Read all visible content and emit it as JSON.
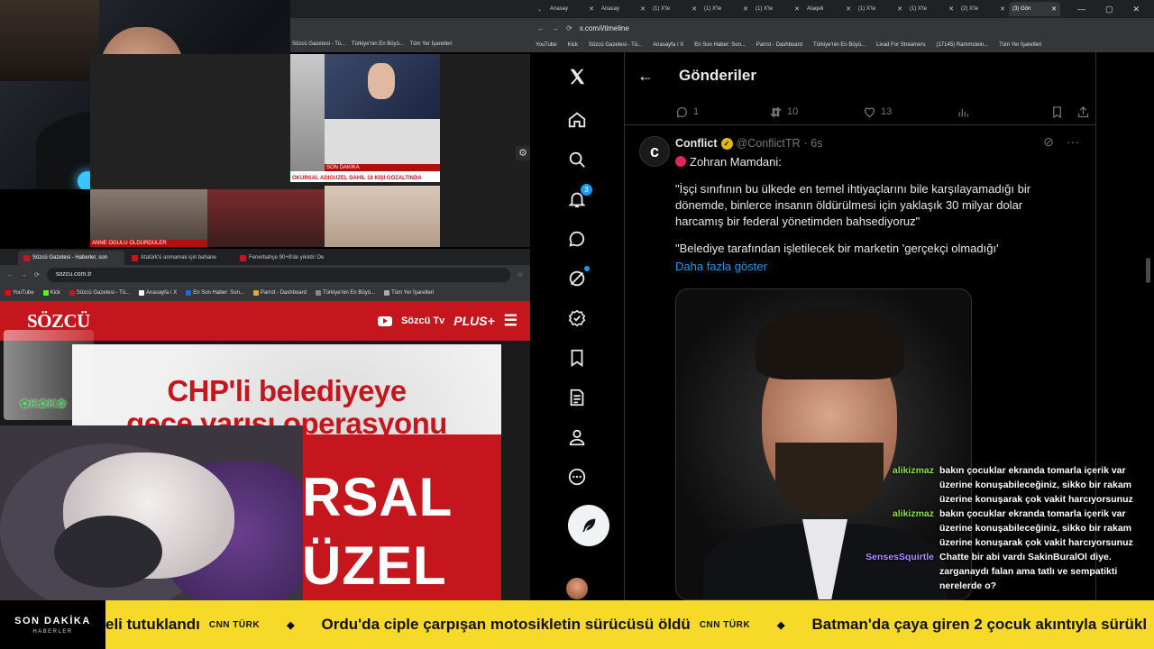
{
  "topLeftWindow": {
    "bookmarks": [
      "Sözcü Gazetesi - Tü...",
      "Türkiye'nin En Büyü...",
      "Tüm Yer İşaretleri"
    ]
  },
  "collage": {
    "captions": [
      "SON DAKİKA",
      "ANNE OĞULU ÖLDÜRDÜLER",
      "OKURSAL ADIGÜZEL DAHİL 18 KİŞİ GÖZALTINDA"
    ]
  },
  "sozcuWindow": {
    "tabs": [
      {
        "label": "Sözcü Gazetesi - Haberler, son"
      },
      {
        "label": "Atatürk'ü anmamak için bahane"
      },
      {
        "label": "Fenerbahçe 90+8'de yıkıldı! De"
      }
    ],
    "url": "sozcu.com.tr",
    "bookmarks": [
      "YouTube",
      "Kick",
      "Sözcü Gazetesi - Tü...",
      "Anasayfa / X",
      "En Son Haber: Son...",
      "Parrot - Dashboard",
      "Türkiye'nin En Büyü...",
      "Tüm Yer İşaretleri"
    ],
    "logo": "SÖZCÜ",
    "tv_label": "Sözcü Tv",
    "plus_label": "PLUS+",
    "hero_title_line1": "CHP'li belediyeye",
    "hero_title_line2": "gece yarısı operasyonu",
    "hero_big_line1": "RSAL",
    "hero_big_line2": "ÜZEL",
    "overlay_text": "✿K✿K✿"
  },
  "xWindow": {
    "tabs": [
      "Anasay",
      "Anasay",
      "(1) X'te",
      "(1) X'te",
      "(1) X'te",
      "Ataqeli",
      "(1) X'te",
      "(1) X'te",
      "(2) X'te",
      "(3) Gön"
    ],
    "url": "x.com/i/timeline",
    "bookmarks": [
      "YouTube",
      "Kick",
      "Sözcü Gazetesi - Tü...",
      "Anasayfa / X",
      "En Son Haber: Son...",
      "Parrot - Dashboard",
      "Türkiye'nin En Büyü...",
      "Livad For Streamers",
      "(17145) Rammstein...",
      "Tüm Yer İşaretleri"
    ],
    "nav": {
      "notification_count": "3"
    },
    "header_title": "Gönderiler",
    "prev_post_stats": {
      "replies": "1",
      "reposts": "10",
      "likes": "13"
    },
    "post": {
      "avatar_letter": "c",
      "name": "Conflict",
      "handle": "@ConflictTR",
      "time": "· 6s",
      "line1": "Zohran Mamdani:",
      "quote1": "\"İşçi sınıfının bu ülkede en temel ihtiyaçlarını bile karşılayamadığı bir dönemde, binlerce insanın öldürülmesi için yaklaşık 30 milyar dolar harcamış bir federal yönetimden bahsediyoruz\"",
      "quote2": "\"Belediye tarafından işletilecek bir marketin 'gerçekçi olmadığı'",
      "show_more": "Daha fazla göster"
    }
  },
  "chat": [
    {
      "user": "alikizmaz",
      "color": "#8be04e",
      "text": "bakın çocuklar ekranda tomarla içerik var üzerine konuşabileceğiniz, sikko bir rakam üzerine konuşarak çok vakit harcıyorsunuz"
    },
    {
      "user": "alikizmaz",
      "color": "#8be04e",
      "text": "bakın çocuklar ekranda tomarla içerik var üzerine konuşabileceğiniz, sikko bir rakam üzerine konuşarak çok vakit harcıyorsunuz"
    },
    {
      "user": "SensesSquirtle",
      "color": "#b48cff",
      "text": "Chatte bir abi vardı SakinBuralOl diye. zarganaydı falan ama tatlı ve sempatikti nerelerde o?"
    }
  ],
  "ticker": {
    "badge_line1": "SON DAKİKA",
    "badge_line2": "HABERLER",
    "items": [
      {
        "text": "eli tutuklandı",
        "source": "CNN TÜRK"
      },
      {
        "text": "Ordu'da ciple çarpışan motosikletin sürücüsü öldü",
        "source": "CNN TÜRK"
      },
      {
        "text": "Batman'da çaya giren 2 çocuk akıntıyla sürükl",
        "source": ""
      }
    ]
  },
  "colors": {
    "x_blue": "#1d9bf0",
    "sozcu_red": "#c4161c",
    "ticker_yellow": "#f7d92a"
  }
}
